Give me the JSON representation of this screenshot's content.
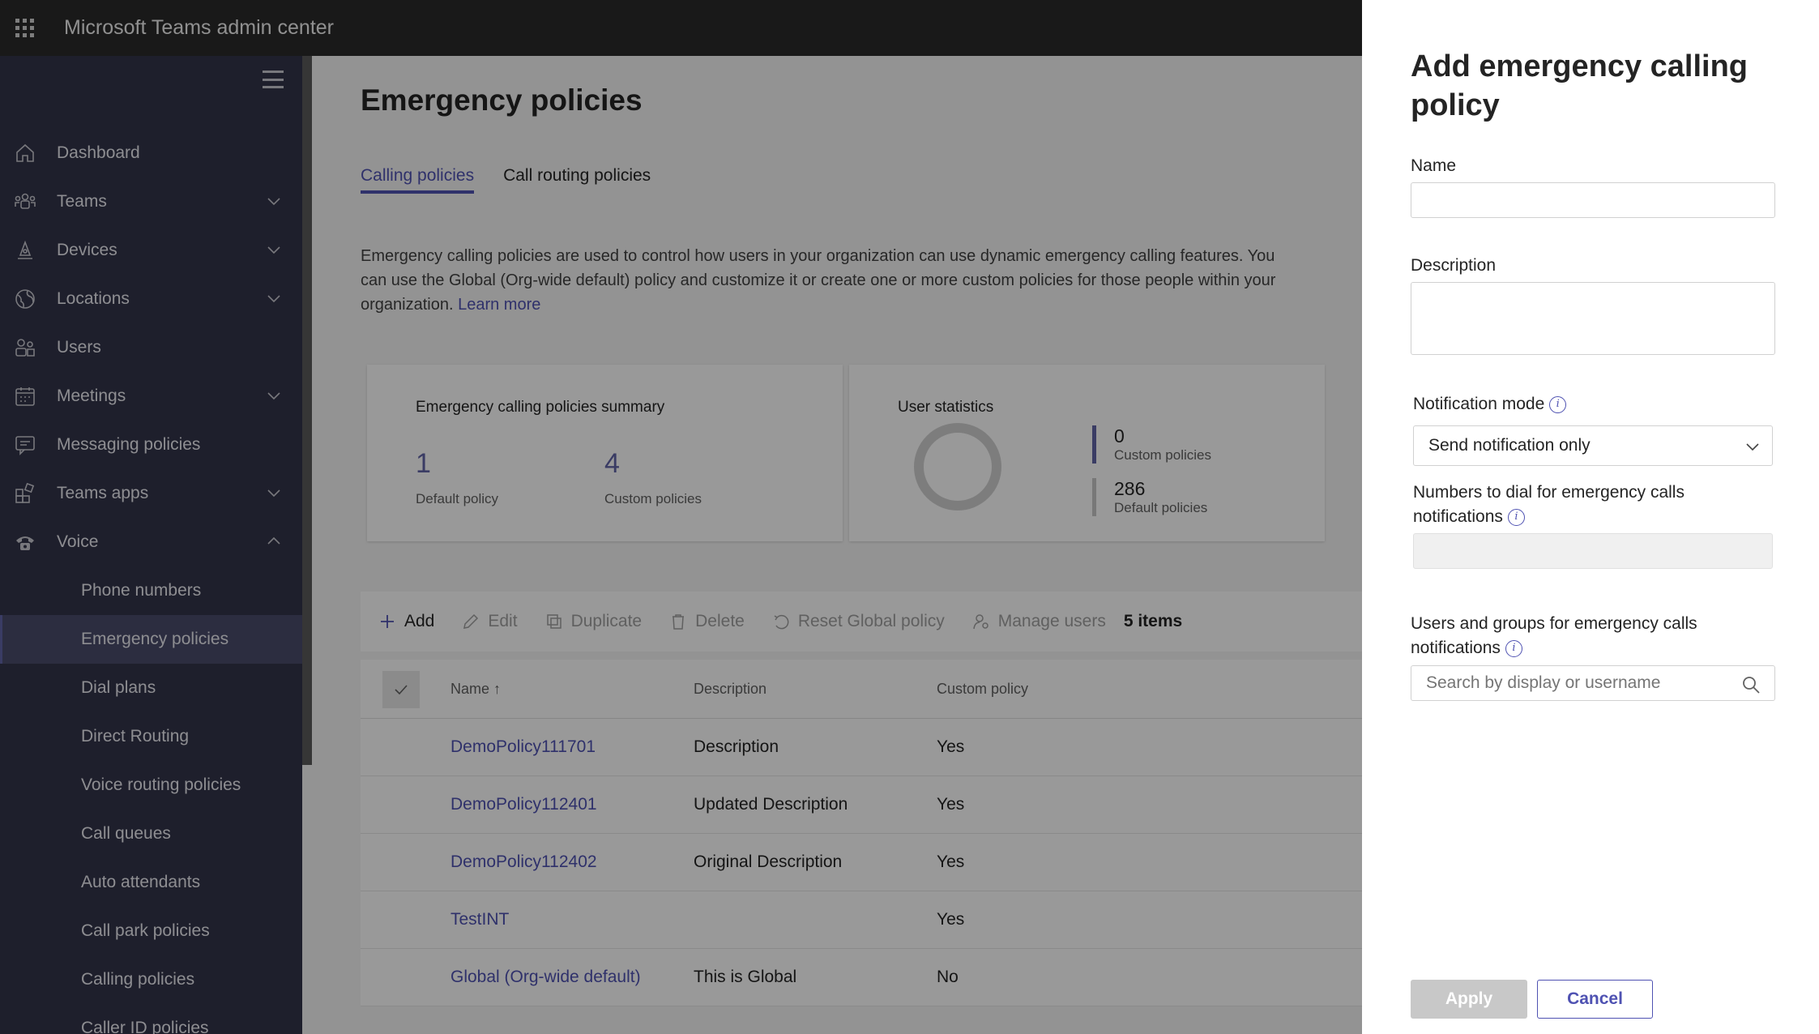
{
  "app": {
    "title": "Microsoft Teams admin center"
  },
  "sidebar": {
    "items": [
      {
        "label": "Dashboard",
        "icon": "home-icon",
        "expandable": false
      },
      {
        "label": "Teams",
        "icon": "teams-icon",
        "expandable": true
      },
      {
        "label": "Devices",
        "icon": "devices-icon",
        "expandable": true
      },
      {
        "label": "Locations",
        "icon": "globe-icon",
        "expandable": true
      },
      {
        "label": "Users",
        "icon": "users-icon",
        "expandable": false
      },
      {
        "label": "Meetings",
        "icon": "calendar-icon",
        "expandable": true
      },
      {
        "label": "Messaging policies",
        "icon": "chat-icon",
        "expandable": false
      },
      {
        "label": "Teams apps",
        "icon": "apps-icon",
        "expandable": true
      },
      {
        "label": "Voice",
        "icon": "phone-icon",
        "expandable": true,
        "expanded": true
      }
    ],
    "voice_sub": [
      "Phone numbers",
      "Emergency policies",
      "Dial plans",
      "Direct Routing",
      "Voice routing policies",
      "Call queues",
      "Auto attendants",
      "Call park policies",
      "Calling policies",
      "Caller ID policies"
    ],
    "active": "Emergency policies"
  },
  "main": {
    "title": "Emergency policies",
    "tabs": [
      "Calling policies",
      "Call routing policies"
    ],
    "active_tab": "Calling policies",
    "description": "Emergency calling policies are used to control how users in your organization can use dynamic emergency calling features. You can use the Global (Org-wide default) policy and customize it or create one or more custom policies for those people within your organization.",
    "learn_more": "Learn more",
    "summary": {
      "title": "Emergency calling policies summary",
      "default_count": "1",
      "default_label": "Default policy",
      "custom_count": "4",
      "custom_label": "Custom policies"
    },
    "user_stats": {
      "title": "User statistics",
      "custom_count": "0",
      "custom_label": "Custom policies",
      "default_count": "286",
      "default_label": "Default policies"
    },
    "toolbar": {
      "add": "Add",
      "edit": "Edit",
      "duplicate": "Duplicate",
      "delete": "Delete",
      "reset": "Reset Global policy",
      "manage": "Manage users",
      "count": "5 items"
    },
    "table": {
      "headers": {
        "name": "Name",
        "description": "Description",
        "custom": "Custom policy"
      },
      "rows": [
        {
          "name": "DemoPolicy111701",
          "description": "Description",
          "custom": "Yes"
        },
        {
          "name": "DemoPolicy112401",
          "description": "Updated Description",
          "custom": "Yes"
        },
        {
          "name": "DemoPolicy112402",
          "description": "Original Description",
          "custom": "Yes"
        },
        {
          "name": "TestINT",
          "description": "",
          "custom": "Yes"
        },
        {
          "name": "Global (Org-wide default)",
          "description": "This is Global",
          "custom": "No"
        }
      ]
    }
  },
  "panel": {
    "title": "Add emergency calling policy",
    "name_label": "Name",
    "name_value": "",
    "description_label": "Description",
    "description_value": "",
    "notification_label": "Notification mode",
    "notification_value": "Send notification only",
    "numbers_label_1": "Numbers to dial for emergency calls",
    "numbers_label_2": "notifications",
    "users_label_1": "Users and groups for emergency calls",
    "users_label_2": "notifications",
    "search_placeholder": "Search by display or username",
    "apply": "Apply",
    "cancel": "Cancel"
  },
  "colors": {
    "accent": "#4f52b2",
    "sidebar": "#33344a",
    "topbar": "#2b2b2b"
  }
}
